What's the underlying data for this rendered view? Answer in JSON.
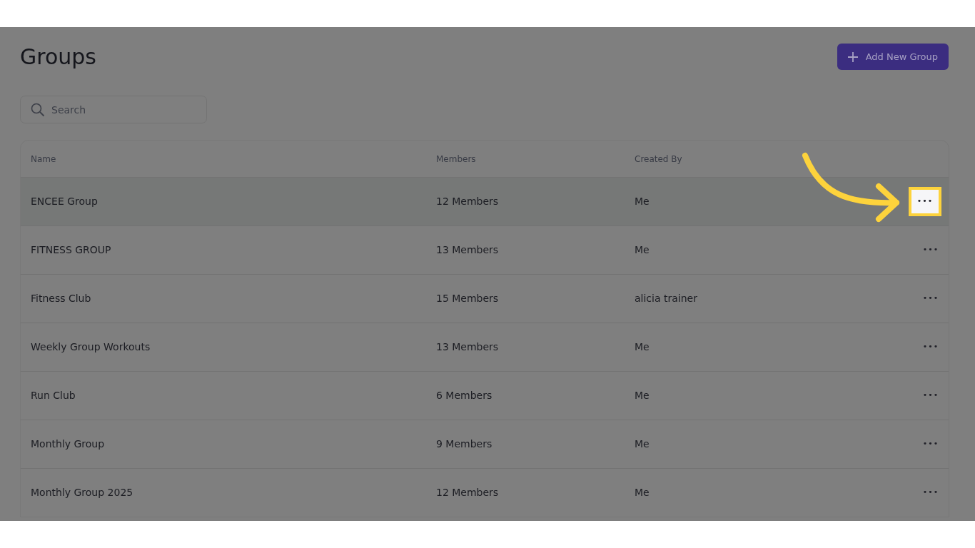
{
  "page": {
    "title": "Groups"
  },
  "add_button": {
    "label": "Add New Group"
  },
  "search": {
    "placeholder": "Search"
  },
  "table": {
    "columns": [
      "Name",
      "Members",
      "Created By"
    ],
    "rows": [
      {
        "name": "ENCEE Group",
        "members": "12 Members",
        "created_by": "Me",
        "actions": "•••",
        "highlighted": true
      },
      {
        "name": "FITNESS GROUP",
        "members": "13 Members",
        "created_by": "Me",
        "actions": "•••",
        "highlighted": false
      },
      {
        "name": "Fitness Club",
        "members": "15 Members",
        "created_by": "alicia trainer",
        "actions": "•••",
        "highlighted": false
      },
      {
        "name": "Weekly Group Workouts",
        "members": "13 Members",
        "created_by": "Me",
        "actions": "•••",
        "highlighted": false
      },
      {
        "name": "Run Club",
        "members": "6 Members",
        "created_by": "Me",
        "actions": "•••",
        "highlighted": false
      },
      {
        "name": "Monthly Group",
        "members": "9 Members",
        "created_by": "Me",
        "actions": "•••",
        "highlighted": false
      },
      {
        "name": "Monthly Group 2025",
        "members": "12 Members",
        "created_by": "Me",
        "actions": "•••",
        "highlighted": false
      }
    ]
  }
}
